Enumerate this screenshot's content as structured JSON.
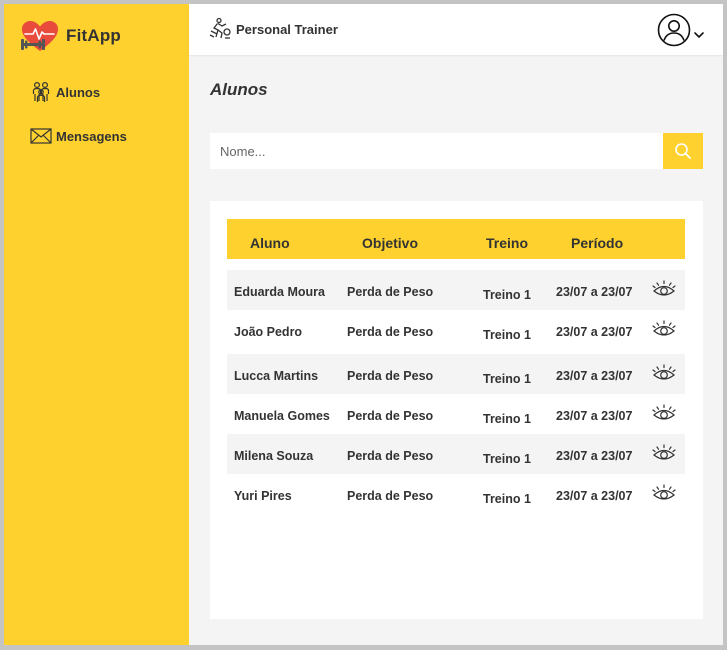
{
  "app": {
    "name": "FitApp",
    "logo_icon": "heart-dumbbell-icon"
  },
  "sidebar": {
    "items": [
      {
        "label": "Alunos",
        "icon": "students-icon"
      },
      {
        "label": "Mensagens",
        "icon": "envelope-icon"
      }
    ]
  },
  "header": {
    "role_label": "Personal Trainer",
    "role_icon": "trainer-icon",
    "account_icon": "user-account-icon"
  },
  "main": {
    "title": "Alunos",
    "search": {
      "value": "",
      "placeholder": "Nome..."
    },
    "table": {
      "headers": [
        "Aluno",
        "Objetivo",
        "Treino",
        "Período"
      ],
      "rows": [
        {
          "aluno": "Eduarda Moura",
          "objetivo": "Perda de Peso",
          "treino": "Treino 1",
          "periodo": "23/07 a 23/07"
        },
        {
          "aluno": "João Pedro",
          "objetivo": "Perda de Peso",
          "treino": "Treino 1",
          "periodo": "23/07 a 23/07"
        },
        {
          "aluno": "Lucca Martins",
          "objetivo": "Perda de Peso",
          "treino": "Treino 1",
          "periodo": "23/07 a 23/07"
        },
        {
          "aluno": "Manuela Gomes",
          "objetivo": "Perda de Peso",
          "treino": "Treino 1",
          "periodo": "23/07 a 23/07"
        },
        {
          "aluno": "Milena Souza",
          "objetivo": "Perda de Peso",
          "treino": "Treino 1",
          "periodo": "23/07 a 23/07"
        },
        {
          "aluno": "Yuri Pires",
          "objetivo": "Perda de Peso",
          "treino": "Treino 1",
          "periodo": "23/07 a 23/07"
        }
      ]
    }
  },
  "colors": {
    "accent": "#fed12e",
    "background": "#f4f4f4",
    "text": "#333333",
    "logo_heart": "#e84a3c"
  }
}
